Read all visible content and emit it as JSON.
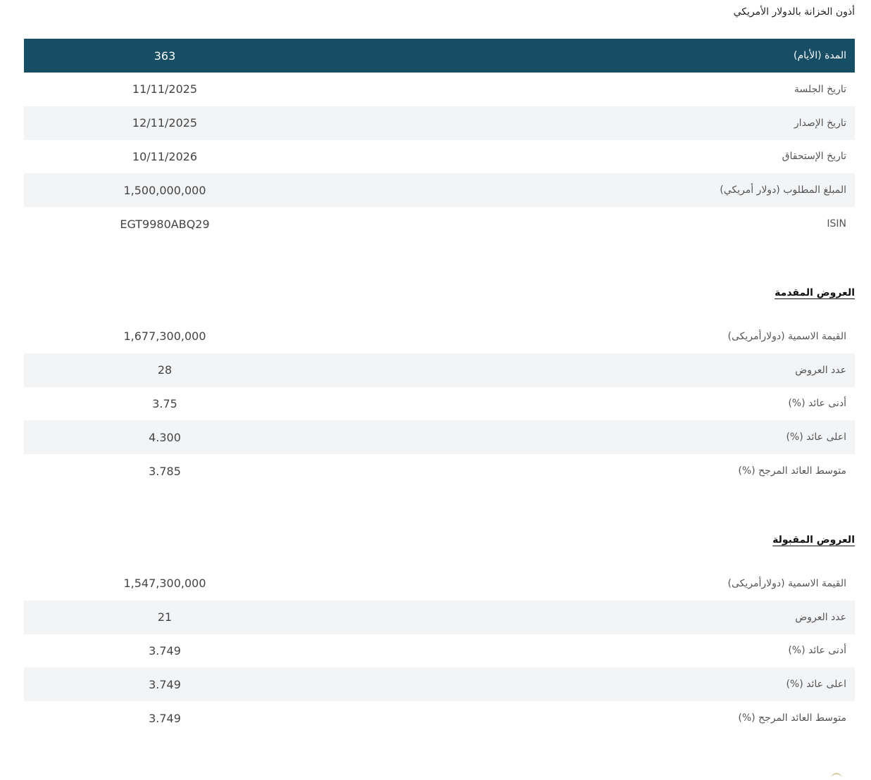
{
  "page_title": "أذون الخزانة بالدولار الأمريكي",
  "details": {
    "header": {
      "label": "المدة (الأيام)",
      "value": "363"
    },
    "rows": [
      {
        "label": "تاريخ الجلسة",
        "value": "11/11/2025"
      },
      {
        "label": "تاريخ الإصدار",
        "value": "12/11/2025"
      },
      {
        "label": "تاريخ الإستحقاق",
        "value": "10/11/2026"
      },
      {
        "label": "المبلغ المطلوب (دولار أمريكي)",
        "value": "1,500,000,000"
      },
      {
        "label": "ISIN",
        "value": "EGT9980ABQ29"
      }
    ]
  },
  "bids_submitted": {
    "title": "العروض المقدمة",
    "rows": [
      {
        "label": "القيمة الاسمية (دولارأمريكى)",
        "value": "1,677,300,000"
      },
      {
        "label": "عدد العروض",
        "value": "28"
      },
      {
        "label": "أدنى عائد (%)",
        "value": "3.75"
      },
      {
        "label": "اعلى عائد (%)",
        "value": "4.300"
      },
      {
        "label": "متوسط العائد المرجح (%)",
        "value": "3.785"
      }
    ]
  },
  "bids_accepted": {
    "title": "العروض المقبولة",
    "rows": [
      {
        "label": "القيمة الاسمية (دولارأمريكى)",
        "value": "1,547,300,000"
      },
      {
        "label": "عدد العروض",
        "value": "21"
      },
      {
        "label": "أدنى عائد (%)",
        "value": "3.749"
      },
      {
        "label": "اعلى عائد (%)",
        "value": "3.749"
      },
      {
        "label": "متوسط العائد المرجح (%)",
        "value": "3.749"
      }
    ]
  },
  "colors": {
    "header_bg": "#164e66",
    "alt_row_bg": "#f3f4f6"
  }
}
